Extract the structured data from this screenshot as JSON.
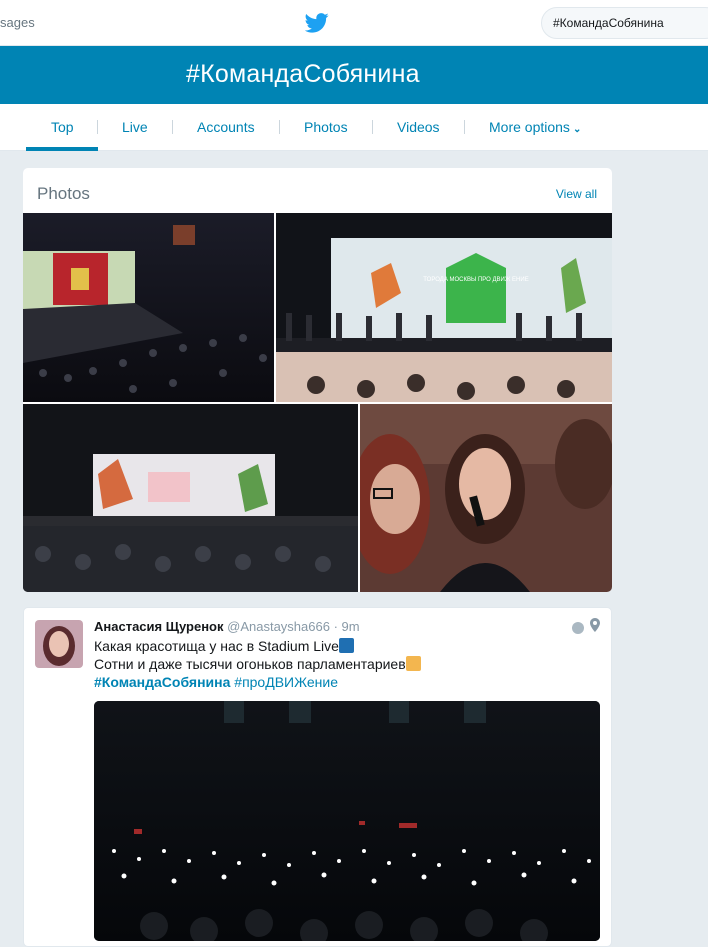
{
  "topbar": {
    "messages_label": "sages",
    "search_value": "#КомандаСобянина"
  },
  "banner": {
    "title": "#КомандаСобянина"
  },
  "tabs": [
    {
      "label": "Top",
      "active": true
    },
    {
      "label": "Live"
    },
    {
      "label": "Accounts"
    },
    {
      "label": "Photos"
    },
    {
      "label": "Videos"
    },
    {
      "label": "More options"
    }
  ],
  "photos_section": {
    "heading": "Photos",
    "view_all": "View all",
    "photo2_sign": "ТОРОДА МОСКВЫ ПРО ДВИЖ ЕНИЕ"
  },
  "tweet": {
    "name": "Анастасия Щуренок",
    "handle": "@Anastaysha666",
    "separator": "·",
    "time": "9m",
    "line1": "Какая красотища у нас в Stadium Live",
    "line2": "Сотни и даже тысячи огоньков парламентариев",
    "hashtag1": "#КомандаСобянина",
    "hashtag2": "#проДВИЖение"
  },
  "colors": {
    "brand": "#0084b4",
    "background": "#e6ecf0",
    "muted": "#66757f"
  },
  "icons": [
    "twitter-bird-icon",
    "chevron-down-icon",
    "globe-icon",
    "location-pin-icon",
    "sparkle-emoji",
    "raising-hand-emoji"
  ]
}
